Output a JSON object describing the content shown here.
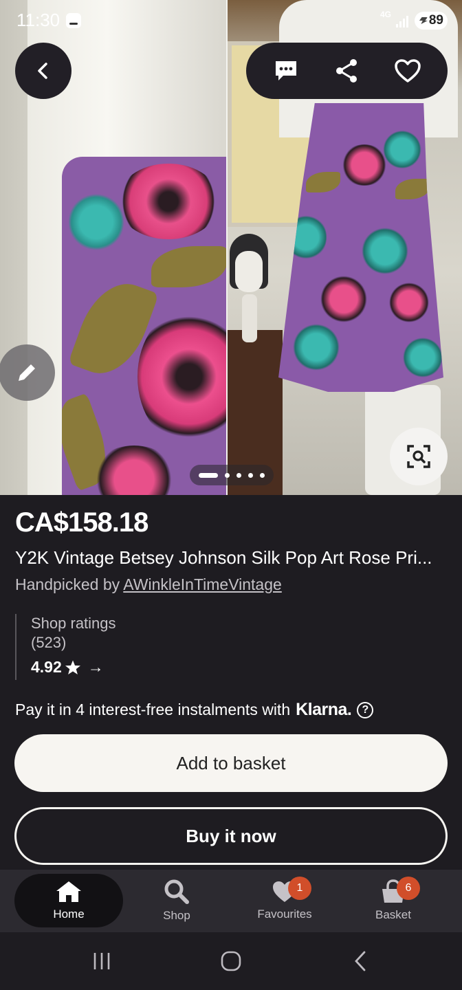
{
  "status_bar": {
    "time": "11:30",
    "network": "4G",
    "battery": "89"
  },
  "gallery": {
    "back_label": "back",
    "actions": [
      "message",
      "share",
      "favourite"
    ],
    "page_count": 5,
    "current_page": 1
  },
  "listing": {
    "price": "CA$158.18",
    "title": "Y2K Vintage Betsey Johnson Silk Pop Art Rose Pri...",
    "handpicked_prefix": "Handpicked by ",
    "shop_name": "AWinkleInTimeVintage"
  },
  "ratings": {
    "label": "Shop ratings",
    "count": "(523)",
    "score": "4.92",
    "arrow": "→"
  },
  "payment": {
    "text": "Pay it in 4 interest-free instalments with",
    "provider": "Klarna.",
    "help": "?"
  },
  "buttons": {
    "add_to_basket": "Add to basket",
    "buy_now": "Buy it now"
  },
  "bottom_nav": {
    "home": "Home",
    "shop": "Shop",
    "favourites": "Favourites",
    "favourites_badge": "1",
    "basket": "Basket",
    "basket_badge": "6"
  },
  "colors": {
    "background": "#1e1c21",
    "badge": "#d14e2a",
    "primary_button": "#f7f5f1"
  }
}
